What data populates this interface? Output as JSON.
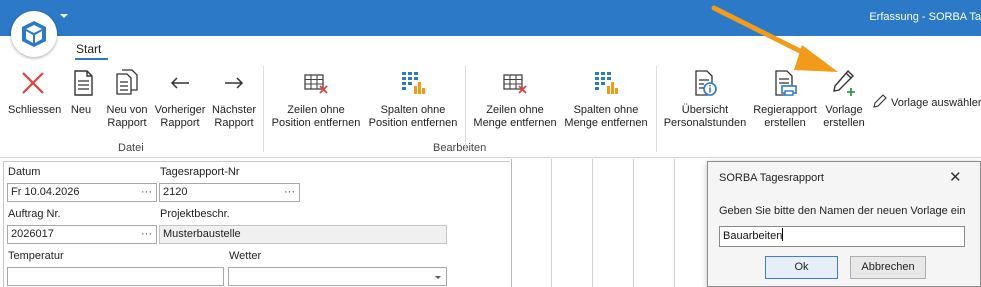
{
  "window": {
    "title": "Erfassung - SORBA Ta",
    "tab": "Start",
    "accent": "#2b79c7"
  },
  "ribbon": {
    "groups": {
      "datei": "Datei",
      "bearbeiten": "Bearbeiten"
    },
    "buttons": {
      "schliessen": "Schliessen",
      "neu": "Neu",
      "neu_von_rapport": [
        "Neu von",
        "Rapport"
      ],
      "vorheriger": [
        "Vorheriger",
        "Rapport"
      ],
      "naechster": [
        "Nächster",
        "Rapport"
      ],
      "zeilen_pos": [
        "Zeilen ohne",
        "Position entfernen"
      ],
      "spalten_pos": [
        "Spalten ohne",
        "Position entfernen"
      ],
      "zeilen_menge": [
        "Zeilen ohne",
        "Menge entfernen"
      ],
      "spalten_menge": [
        "Spalten ohne",
        "Menge entfernen"
      ],
      "uebersicht": [
        "Übersicht",
        "Personalstunden"
      ],
      "regierapport": [
        "Regierapport",
        "erstellen"
      ],
      "vorlage_erstellen": [
        "Vorlage",
        "erstellen"
      ],
      "vorlage_auswaehlen": "Vorlage auswählen"
    }
  },
  "form": {
    "datum_label": "Datum",
    "datum_value": "Fr 10.04.2026",
    "tagesrapport_label": "Tagesrapport-Nr",
    "tagesrapport_value": "2120",
    "auftrag_label": "Auftrag Nr.",
    "auftrag_value": "2026017",
    "projekt_label": "Projektbeschr.",
    "projekt_value": "Musterbaustelle",
    "temperatur_label": "Temperatur",
    "temperatur_value": "",
    "wetter_label": "Wetter",
    "wetter_value": "",
    "ellipsis": "···"
  },
  "dialog": {
    "title": "SORBA Tagesrapport",
    "close": "✕",
    "prompt": "Geben Sie bitte den Namen der neuen Vorlage ein",
    "input_value": "Bauarbeiten",
    "ok_label": "Ok",
    "cancel_label": "Abbrechen"
  },
  "annotation": {
    "arrow_color": "#f29b1b"
  }
}
